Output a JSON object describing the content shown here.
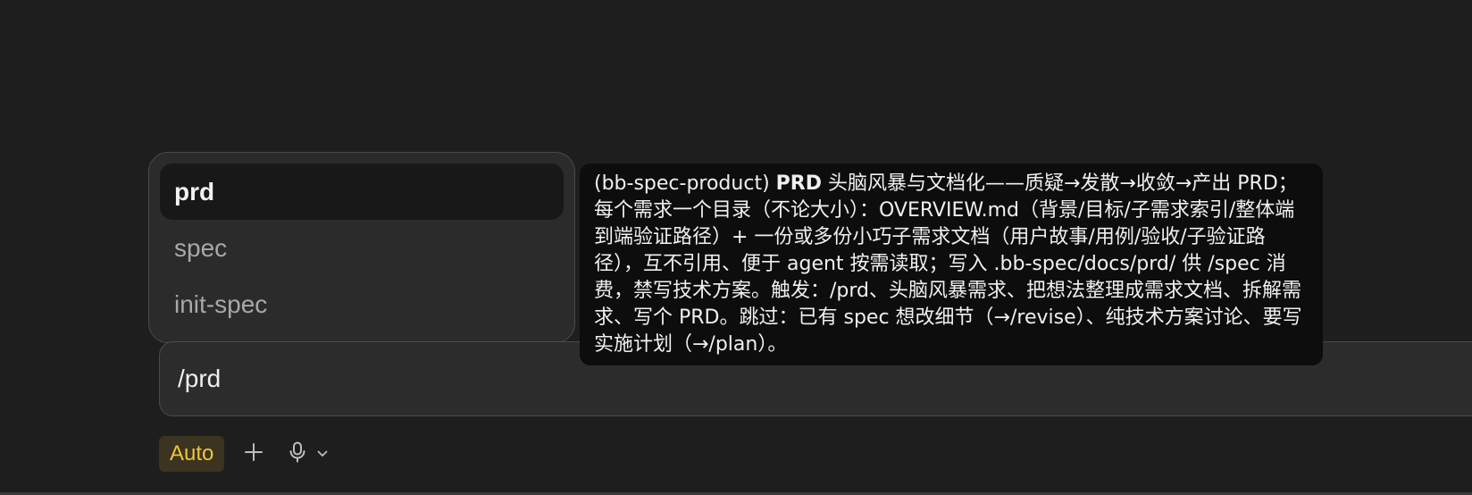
{
  "command_popup": {
    "items": [
      {
        "label": "prd",
        "selected": true
      },
      {
        "label": "spec",
        "selected": false
      },
      {
        "label": "init-spec",
        "selected": false
      }
    ]
  },
  "tooltip": {
    "source": "(bb-spec-product)",
    "command": "PRD",
    "description": "头脑风暴与文档化——质疑→发散→收敛→产出 PRD；每个需求一个目录（不论大小）：OVERVIEW.md（背景/目标/子需求索引/整体端到端验证路径）+ 一份或多份小巧子需求文档（用户故事/用例/验收/子验证路径），互不引用、便于 agent 按需读取；写入 .bb-spec/docs/prd/ 供 /spec 消费，禁写技术方案。触发：/prd、头脑风暴需求、把想法整理成需求文档、拆解需求、写个 PRD。跳过：已有 spec 想改细节（→/revise）、纯技术方案讨论、要写实施计划（→/plan）。"
  },
  "composer": {
    "value": "/prd"
  },
  "toolbar": {
    "mode_label": "Auto",
    "add_icon": "plus-icon",
    "mic_icon": "microphone-icon",
    "chevron_icon": "chevron-down-icon"
  },
  "colors": {
    "background": "#1e1e1e",
    "mode_accent": "#f0c43a",
    "mode_background": "#3a3420",
    "tooltip_background": "#0d0d0d"
  }
}
